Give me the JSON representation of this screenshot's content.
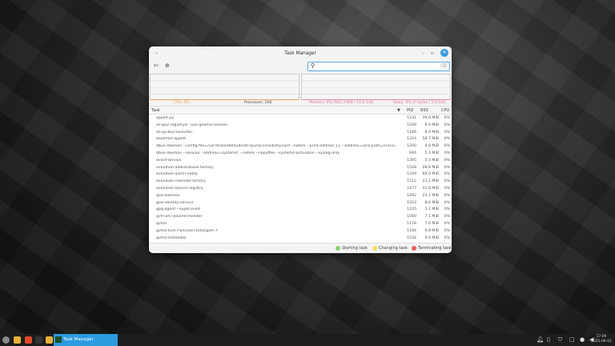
{
  "window": {
    "title": "Task Manager"
  },
  "toolbar": {
    "search_placeholder": ""
  },
  "status": {
    "cpu": "CPU: 0%",
    "processes": "Processes: 206",
    "memory": "Memory: 6% (942.3 MiB / 15.6 GiB)",
    "swap": "Swap: 0% (0 bytes / 2.0 GiB)"
  },
  "colors": {
    "cpu": "#f0a060",
    "memory": "#e07098",
    "accent": "#3b9ae1",
    "starting": "#8fcf70",
    "changing": "#f2e060",
    "terminating": "#e55d5d"
  },
  "table": {
    "headers": {
      "task": "Task",
      "pid": "PID",
      "rss": "RSS",
      "cpu": "CPU"
    },
    "rows": [
      {
        "task": "applet.py",
        "pid": "1331",
        "rss": "39.6 MiB",
        "cpu": "0%"
      },
      {
        "task": "at-spi2-registryd --use-gnome-session",
        "pid": "1209",
        "rss": "8.0 MiB",
        "cpu": "0%"
      },
      {
        "task": "at-spi-bus-launcher",
        "pid": "1186",
        "rss": "8.0 MiB",
        "cpu": "0%"
      },
      {
        "task": "blueman-applet",
        "pid": "1324",
        "rss": "58.7 MiB",
        "cpu": "0%"
      },
      {
        "task": "dbus-daemon --config-file=/usr/share/defaults/at-spi2/accessibility.conf --nofork --print-address 11 --address=unix:path=/run/u...",
        "pid": "1200",
        "rss": "4.8 MiB",
        "cpu": "0%"
      },
      {
        "task": "dbus-daemon --session --address=systemd: --nofork --nopidfile --systemd-activation --syslog-only",
        "pid": "944",
        "rss": "5.3 MiB",
        "cpu": "0%"
      },
      {
        "task": "dconf-service",
        "pid": "1395",
        "rss": "5.5 MiB",
        "cpu": "0%"
      },
      {
        "task": "evolution-addressbook-factory",
        "pid": "1528",
        "rss": "28.8 MiB",
        "cpu": "0%"
      },
      {
        "task": "evolution-alarm-notify",
        "pid": "1349",
        "rss": "60.0 MiB",
        "cpu": "0%"
      },
      {
        "task": "evolution-calendar-factory",
        "pid": "1512",
        "rss": "23.2 MiB",
        "cpu": "0%"
      },
      {
        "task": "evolution-source-registry",
        "pid": "1477",
        "rss": "41.8 MiB",
        "cpu": "0%"
      },
      {
        "task": "goa-daemon",
        "pid": "1492",
        "rss": "23.1 MiB",
        "cpu": "0%"
      },
      {
        "task": "goa-identity-service",
        "pid": "1503",
        "rss": "8.6 MiB",
        "cpu": "0%"
      },
      {
        "task": "gpg-agent --supervised",
        "pid": "1225",
        "rss": "3.1 MiB",
        "cpu": "0%"
      },
      {
        "task": "gvfs-afc-volume-monitor",
        "pid": "1560",
        "rss": "7.5 MiB",
        "cpu": "0%"
      },
      {
        "task": "gvfsd",
        "pid": "1178",
        "rss": "7.6 MiB",
        "cpu": "0%"
      },
      {
        "task": "gvfsd-fuse /run/user/1000/gvfs -f",
        "pid": "1184",
        "rss": "6.8 MiB",
        "cpu": "0%"
      },
      {
        "task": "gvfsd-metadata",
        "pid": "1534",
        "rss": "6.0 MiB",
        "cpu": "0%"
      }
    ]
  },
  "legend": {
    "starting": "Starting task",
    "changing": "Changing task",
    "terminating": "Terminating task"
  },
  "taskbar": {
    "active_task": "Task Manager",
    "time": "17:09",
    "date": "2025-06-01"
  }
}
